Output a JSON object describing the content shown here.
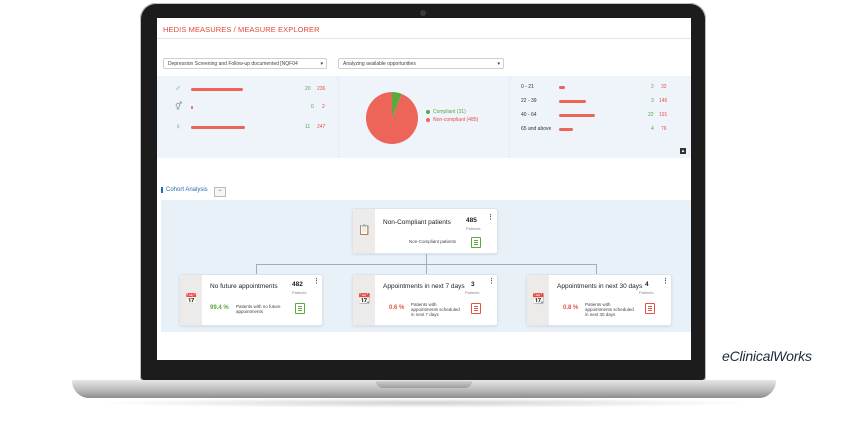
{
  "header": {
    "title": "HEDIS MEASURES / MEASURE EXPLORER"
  },
  "filters": {
    "measure_select": "Depression Screening and Follow-up documented [NQF04",
    "mode_select": "Analyzing available opportunities"
  },
  "gender_stats": [
    {
      "icon": "male-icon",
      "compliant": "20",
      "noncompliant": "236",
      "bar_fraction": 0.92
    },
    {
      "icon": "transgender-icon",
      "compliant": "0",
      "noncompliant": "2",
      "bar_fraction": 0.02
    },
    {
      "icon": "female-icon",
      "compliant": "11",
      "noncompliant": "247",
      "bar_fraction": 0.96
    }
  ],
  "pie": {
    "compliant_label": "Compliant (31)",
    "noncompliant_label": "Non-compliant (485)",
    "compliant_value": 31,
    "noncompliant_value": 485,
    "colors": {
      "compliant": "#5aaa3c",
      "noncompliant": "#ec6558"
    }
  },
  "age_stats": [
    {
      "label": "0 - 21",
      "compliant": "2",
      "noncompliant": "32",
      "bar_fraction": 0.17
    },
    {
      "label": "22 - 39",
      "compliant": "3",
      "noncompliant": "146",
      "bar_fraction": 0.76
    },
    {
      "label": "40 - 64",
      "compliant": "22",
      "noncompliant": "191",
      "bar_fraction": 1.0
    },
    {
      "label": "65 and above",
      "compliant": "4",
      "noncompliant": "76",
      "bar_fraction": 0.4
    }
  ],
  "cohort": {
    "heading": "Cohort Analysis",
    "collapse_label": "−",
    "root": {
      "name": "Non-Compliant patients",
      "count": "485",
      "unit": "Patients",
      "desc": "Non-Compliant patients"
    },
    "children": [
      {
        "name": "No future appointments",
        "count": "482",
        "unit": "Patients",
        "pct": "99.4 %",
        "pct_color": "#5aaa3c",
        "desc": "Patients with no future appointments"
      },
      {
        "name": "Appointments in next 7 days",
        "count": "3",
        "unit": "Patients",
        "pct": "0.6 %",
        "pct_color": "#e35245",
        "desc": "Patients with appointments scheduled in next 7 days"
      },
      {
        "name": "Appointments in next 30 days",
        "count": "4",
        "unit": "Patients",
        "pct": "0.8 %",
        "pct_color": "#e35245",
        "desc": "Patients with appointments scheduled in next 30 days"
      }
    ]
  },
  "brand": "eClinicalWorks"
}
